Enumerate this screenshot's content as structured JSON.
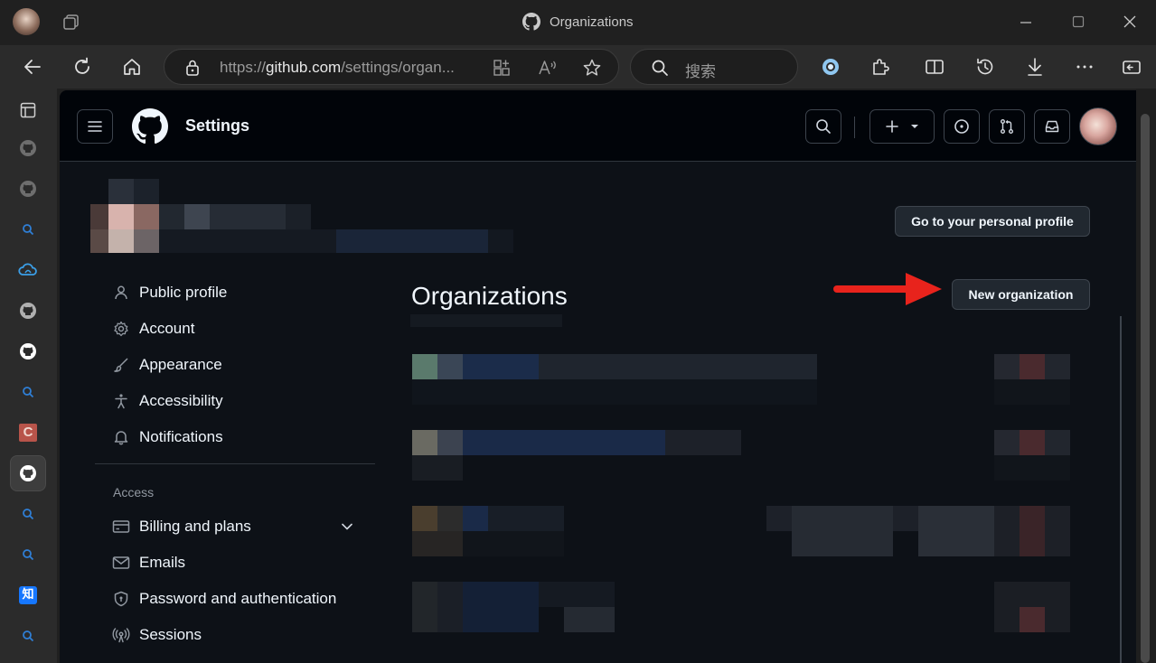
{
  "window": {
    "title": "Organizations"
  },
  "browser": {
    "url_prefix": "https://",
    "url_domain": "github.com",
    "url_path": "/settings/organ...",
    "search_placeholder": "搜索"
  },
  "sidebar_tabs": [
    {
      "name": "tab-actions-icon"
    },
    {
      "name": "github-icon"
    },
    {
      "name": "github-icon"
    },
    {
      "name": "search-icon"
    },
    {
      "name": "cloud-icon"
    },
    {
      "name": "github-icon"
    },
    {
      "name": "github-icon"
    },
    {
      "name": "search-icon"
    },
    {
      "name": "c-app-icon",
      "label": "C"
    },
    {
      "name": "github-icon"
    },
    {
      "name": "search-icon"
    },
    {
      "name": "search-icon"
    },
    {
      "name": "zhihu-icon",
      "label": "知"
    },
    {
      "name": "search-icon"
    }
  ],
  "header": {
    "title": "Settings"
  },
  "profile": {
    "personal_profile_button": "Go to your personal profile"
  },
  "nav": {
    "items": [
      {
        "label": "Public profile",
        "icon": "person-icon"
      },
      {
        "label": "Account",
        "icon": "gear-icon"
      },
      {
        "label": "Appearance",
        "icon": "paintbrush-icon"
      },
      {
        "label": "Accessibility",
        "icon": "accessibility-icon"
      },
      {
        "label": "Notifications",
        "icon": "bell-icon"
      }
    ],
    "access_heading": "Access",
    "access_items": [
      {
        "label": "Billing and plans",
        "icon": "credit-card-icon"
      },
      {
        "label": "Emails",
        "icon": "mail-icon"
      },
      {
        "label": "Password and authentication",
        "icon": "shield-lock-icon"
      },
      {
        "label": "Sessions",
        "icon": "broadcast-icon"
      }
    ]
  },
  "main": {
    "title": "Organizations",
    "new_org_button": "New organization"
  },
  "colors": {
    "annotation_arrow": "#e8231c",
    "background": "#0d1117",
    "header": "#010409"
  }
}
